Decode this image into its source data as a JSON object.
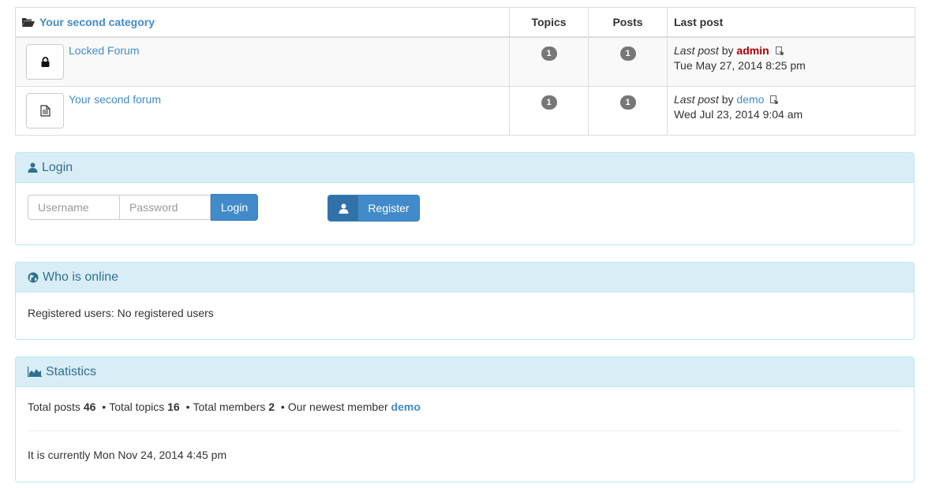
{
  "category": {
    "title": "Your second category",
    "col_topics": "Topics",
    "col_posts": "Posts",
    "col_lastpost": "Last post"
  },
  "forums": [
    {
      "name": "Locked Forum",
      "icon": "lock-icon",
      "topics": "1",
      "posts": "1",
      "last_post_label": "Last post",
      "by": "by",
      "user": "admin",
      "date": "Tue May 27, 2014 8:25 pm"
    },
    {
      "name": "Your second forum",
      "icon": "document-icon",
      "topics": "1",
      "posts": "1",
      "last_post_label": "Last post",
      "by": "by",
      "user": "demo",
      "date": "Wed Jul 23, 2014 9:04 am"
    }
  ],
  "login": {
    "heading": "Login",
    "username_placeholder": "Username",
    "password_placeholder": "Password",
    "login_button": "Login",
    "register_button": "Register"
  },
  "online": {
    "heading": "Who is online",
    "text": "Registered users: No registered users"
  },
  "statistics": {
    "heading": "Statistics",
    "total_posts_label": "Total posts",
    "total_posts": "46",
    "total_topics_label": "Total topics",
    "total_topics": "16",
    "total_members_label": "Total members",
    "total_members": "2",
    "newest_label": "Our newest member",
    "newest_member": "demo",
    "bullet": "•",
    "current_time": "It is currently Mon Nov 24, 2014 4:45 pm"
  },
  "colors": {
    "link": "#428bca",
    "admin": "#aa0000",
    "panel_heading_bg": "#d9edf7",
    "panel_heading_text": "#31708f",
    "badge": "#777777"
  }
}
